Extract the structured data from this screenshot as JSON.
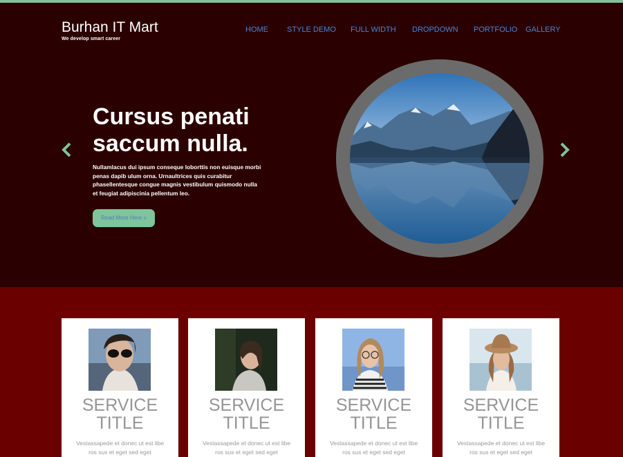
{
  "brand": {
    "name": "Burhan IT Mart",
    "tagline": "We develop smart career"
  },
  "nav": {
    "items": [
      "HOME",
      "STYLE DEMO",
      "FULL WIDTH",
      "DROPDOWN",
      "PORTFOLIO",
      "GALLERY"
    ]
  },
  "slider": {
    "prev_icon": "chevron-left-icon",
    "next_icon": "chevron-right-icon",
    "title_line1": "Cursus penati",
    "title_line2": "saccum nulla.",
    "text": "Nullamlacus dui ipsum conseque loborttis non euisque morbi penas dapib ulum orna. Urnaultrices quis curabitur phasellentesque congue magnis vestibulum quismodo nulla et feugiat adipiscinia pellentum leo.",
    "button_label": "Read More Here »"
  },
  "services": [
    {
      "title": "SERVICE TITLE",
      "text": "Vestassapede et donec ut est libe ros sus et eget sed eget"
    },
    {
      "title": "SERVICE TITLE",
      "text": "Vestassapede et donec ut est libe ros sus et eget sed eget"
    },
    {
      "title": "SERVICE TITLE",
      "text": "Vestassapede et donec ut est libe ros sus et eget sed eget"
    },
    {
      "title": "SERVICE TITLE",
      "text": "Vestassapede et donec ut est libe ros sus et eget sed eget"
    }
  ],
  "colors": {
    "accent_green": "#7fc49a",
    "header_bg": "#2b0000",
    "section_bg": "#6a0000",
    "nav_link": "#4a86d8"
  }
}
